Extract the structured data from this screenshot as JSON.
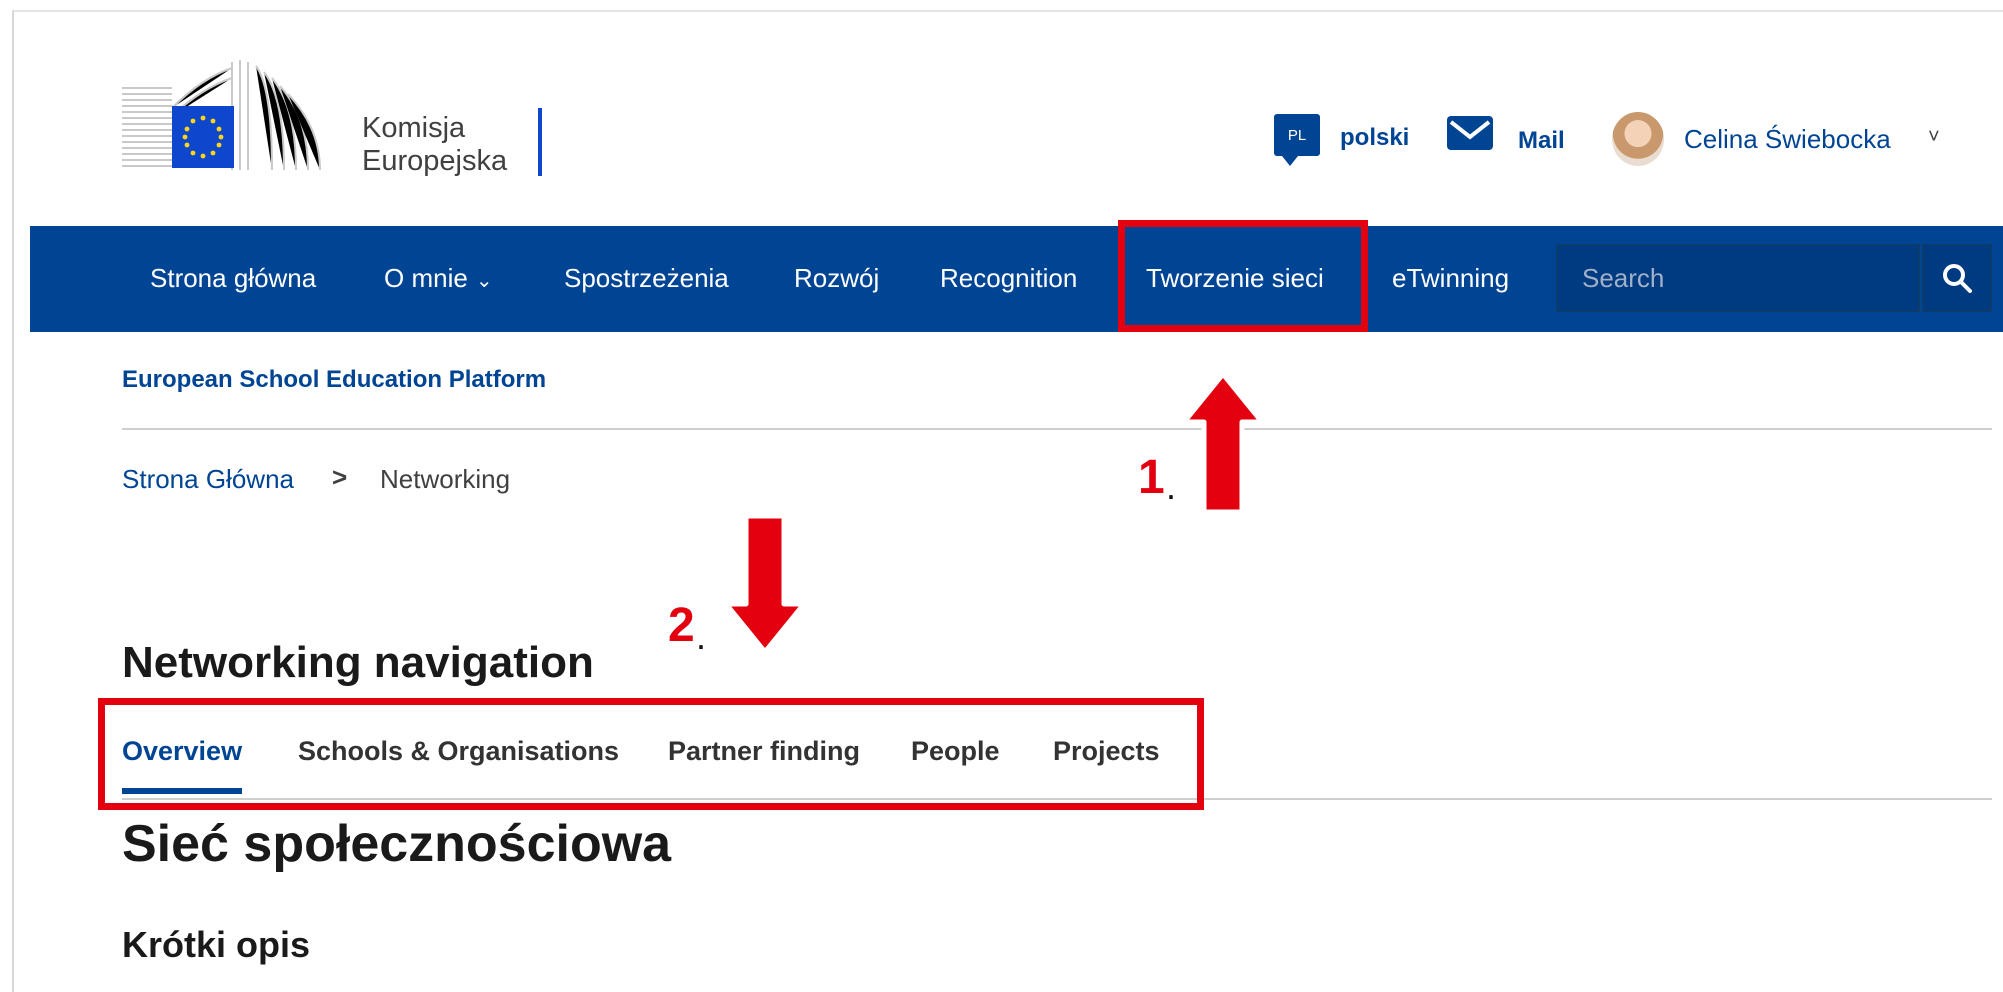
{
  "header": {
    "logo_lines": [
      "Komisja",
      "Europejska"
    ],
    "language": {
      "code": "PL",
      "label": "polski"
    },
    "mail_label": "Mail",
    "user_name": "Celina Świebocka"
  },
  "nav": {
    "items": [
      "Strona główna",
      "O mnie",
      "Spostrzeżenia",
      "Rozwój",
      "Recognition",
      "Tworzenie sieci",
      "eTwinning"
    ],
    "search_placeholder": "Search"
  },
  "platform_name": "European School Education Platform",
  "breadcrumb": [
    "Strona Główna",
    "Networking"
  ],
  "section": {
    "heading": "Networking navigation",
    "tabs": [
      "Overview",
      "Schools & Organisations",
      "Partner finding",
      "People",
      "Projects"
    ],
    "active_tab": "Overview",
    "page_title": "Sieć społecznościowa",
    "subheading": "Krótki opis"
  },
  "annotations": {
    "step1": "1",
    "step2": "2",
    "dot": "."
  },
  "colors": {
    "brand_blue": "#004494",
    "highlight_red": "#e3000f"
  },
  "icons": [
    "eu-flag-logo",
    "speech-bubble-icon",
    "envelope-icon",
    "avatar",
    "chevron-down-icon",
    "search-icon",
    "arrow-up-icon",
    "arrow-down-icon"
  ]
}
